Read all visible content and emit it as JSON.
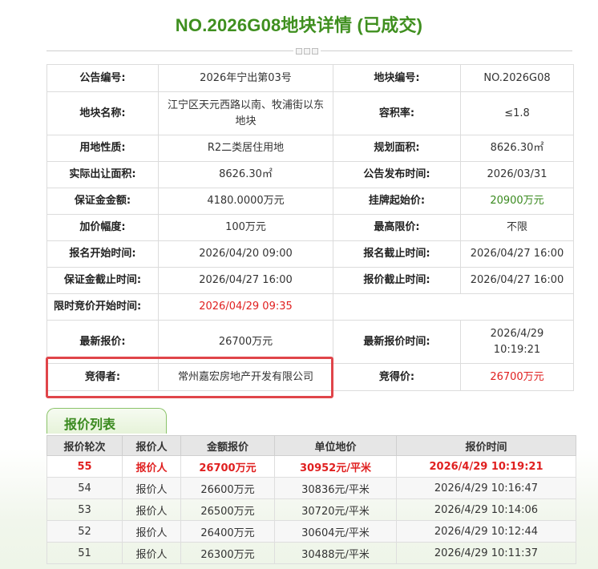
{
  "page": {
    "title": "NO.2026G08地块详情 (已成交)"
  },
  "details": {
    "notice_no_label": "公告编号:",
    "notice_no": "2026年宁出第03号",
    "parcel_no_label": "地块编号:",
    "parcel_no": "NO.2026G08",
    "parcel_name_label": "地块名称:",
    "parcel_name": "江宁区天元西路以南、牧浦街以东地块",
    "plot_ratio_label": "容积率:",
    "plot_ratio": "≤1.8",
    "land_use_label": "用地性质:",
    "land_use": "R2二类居住用地",
    "planned_area_label": "规划面积:",
    "planned_area": "8626.30㎡",
    "actual_area_label": "实际出让面积:",
    "actual_area": "8626.30㎡",
    "publish_time_label": "公告发布时间:",
    "publish_time": "2026/03/31",
    "deposit_label": "保证金金额:",
    "deposit": "4180.0000万元",
    "starting_price_label": "挂牌起始价:",
    "starting_price": "20900万元",
    "increment_label": "加价幅度:",
    "increment": "100万元",
    "max_price_label": "最高限价:",
    "max_price": "不限",
    "reg_start_label": "报名开始时间:",
    "reg_start": "2026/04/20 09:00",
    "reg_end_label": "报名截止时间:",
    "reg_end": "2026/04/27 16:00",
    "deposit_deadline_label": "保证金截止时间:",
    "deposit_deadline": "2026/04/27 16:00",
    "bid_deadline_label": "报价截止时间:",
    "bid_deadline": "2026/04/27 16:00",
    "timed_bid_start_label": "限时竞价开始时间:",
    "timed_bid_start": "2026/04/29 09:35",
    "latest_bid_label": "最新报价:",
    "latest_bid": "26700万元",
    "latest_bid_time_label": "最新报价时间:",
    "latest_bid_time_line1": "2026/4/29",
    "latest_bid_time_line2": "10:19:21",
    "winner_label": "竞得者:",
    "winner": "常州嘉宏房地产开发有限公司",
    "winning_price_label": "竞得价:",
    "winning_price": "26700万元"
  },
  "bid_list": {
    "tab_label": "报价列表",
    "headers": [
      "报价轮次",
      "报价人",
      "金额报价",
      "单位地价",
      "报价时间"
    ],
    "rows": [
      {
        "round": "55",
        "bidder": "报价人",
        "amount": "26700万元",
        "unit_price": "30952元/平米",
        "time": "2026/4/29 10:19:21"
      },
      {
        "round": "54",
        "bidder": "报价人",
        "amount": "26600万元",
        "unit_price": "30836元/平米",
        "time": "2026/4/29 10:16:47"
      },
      {
        "round": "53",
        "bidder": "报价人",
        "amount": "26500万元",
        "unit_price": "30720元/平米",
        "time": "2026/4/29 10:14:06"
      },
      {
        "round": "52",
        "bidder": "报价人",
        "amount": "26400万元",
        "unit_price": "30604元/平米",
        "time": "2026/4/29 10:12:44"
      },
      {
        "round": "51",
        "bidder": "报价人",
        "amount": "26300万元",
        "unit_price": "30488元/平米",
        "time": "2026/4/29 10:11:37"
      }
    ]
  },
  "colors": {
    "title_green": "#3f8f1f",
    "highlight_red": "#e0454a",
    "text_red": "#e02020",
    "price_green": "#3a8a1f"
  }
}
